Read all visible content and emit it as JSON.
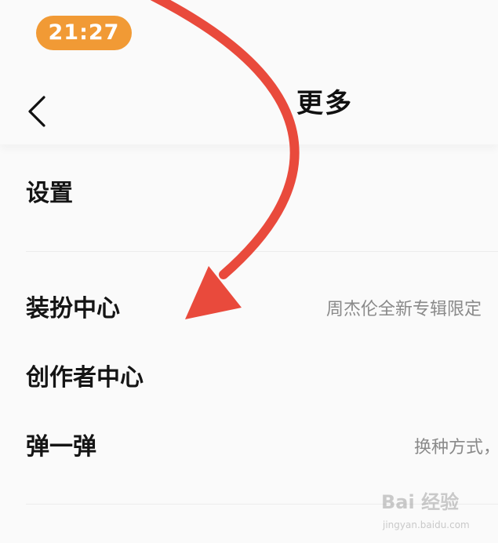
{
  "status_bar": {
    "time": "21:27"
  },
  "header": {
    "title": "更多",
    "back_icon": "chevron-left-icon"
  },
  "menu": {
    "settings": {
      "label": "设置"
    },
    "dress_center": {
      "label": "装扮中心",
      "value": "周杰伦全新专辑限定"
    },
    "creator_center": {
      "label": "创作者中心"
    },
    "bounce": {
      "label": "弹一弹",
      "value": "换种方式，"
    }
  },
  "watermark": {
    "brand": "Bai 经验",
    "url": "jingyan.baidu.com"
  },
  "colors": {
    "status_pill": "#f19a35",
    "annotation_arrow": "#e94a3c",
    "background": "#fafafa"
  }
}
